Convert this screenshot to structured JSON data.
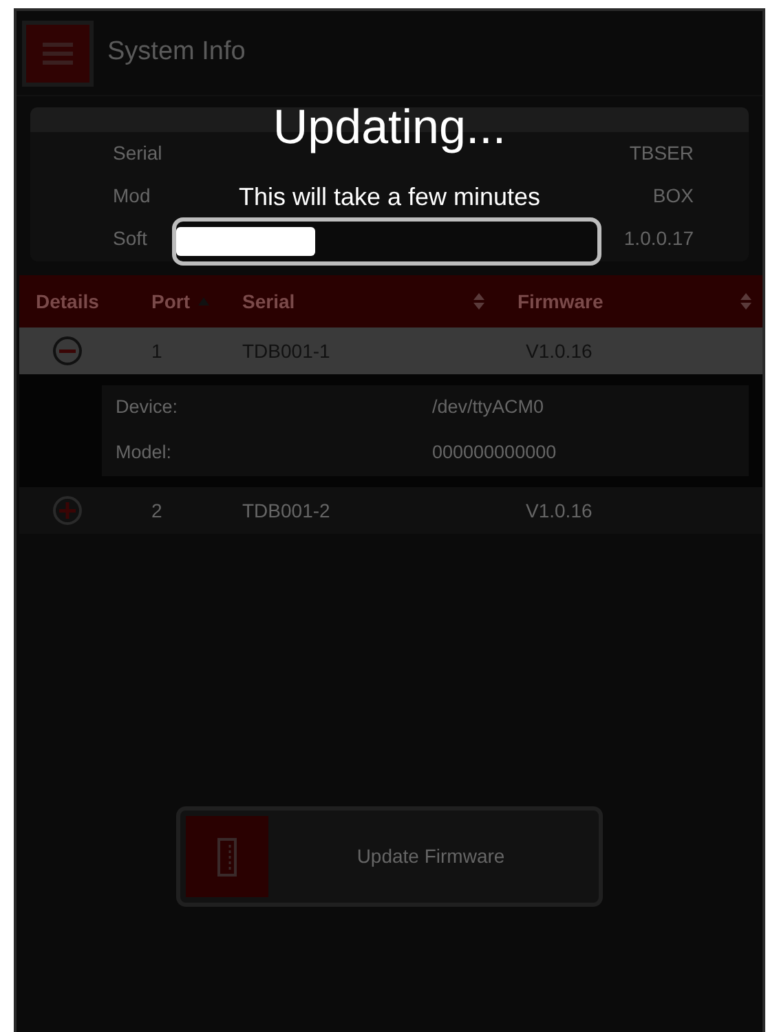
{
  "app_bar": {
    "title": "System Info"
  },
  "system_information": {
    "rows": [
      {
        "label": "Serial",
        "value": "TBSER"
      },
      {
        "label": "Mod",
        "value": "BOX"
      },
      {
        "label": "Soft",
        "value": "1.0.0.17"
      }
    ]
  },
  "ports_table": {
    "columns": [
      {
        "label": "Details"
      },
      {
        "label": "Port",
        "sorted_ascending": true
      },
      {
        "label": "Serial",
        "sorted_ascending": false
      },
      {
        "label": "Firmware",
        "sorted_ascending": false
      }
    ],
    "rows": [
      {
        "expanded": true,
        "port": "1",
        "serial": "TDB001-1",
        "firmware": "V1.0.16",
        "details": [
          {
            "label": "Device:",
            "value": "/dev/ttyACM0"
          },
          {
            "label": "Model:",
            "value": "000000000000"
          }
        ]
      },
      {
        "expanded": false,
        "port": "2",
        "serial": "TDB001-2",
        "firmware": "V1.0.16"
      }
    ]
  },
  "update_button": {
    "label": "Update Firmware"
  },
  "overlay": {
    "title": "Updating...",
    "message": "This will take a few minutes",
    "level": 0.33
  }
}
